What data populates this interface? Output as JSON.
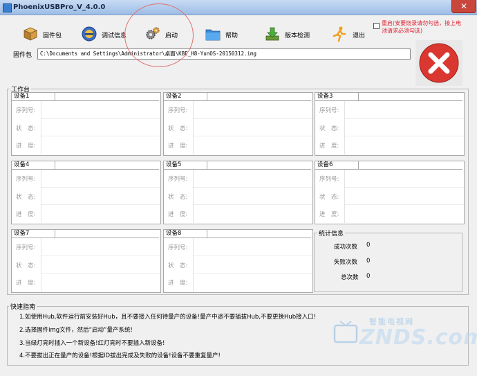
{
  "window": {
    "title": "PhoenixUSBPro_V_4.0.0",
    "close_glyph": "✕"
  },
  "toolbar": {
    "items": [
      {
        "label": "固件包",
        "icon": "package-icon"
      },
      {
        "label": "调试信息",
        "icon": "debug-icon"
      },
      {
        "label": "启动",
        "icon": "gear-icon"
      },
      {
        "label": "帮助",
        "icon": "folder-help-icon"
      },
      {
        "label": "版本检测",
        "icon": "download-icon"
      },
      {
        "label": "退出",
        "icon": "running-man-icon"
      }
    ],
    "restart_text": "重启(安要烧录请勿勾选，接上电池请求必须勾选)"
  },
  "firmware": {
    "label": "固件包",
    "path": "C:\\Documents and Settings\\Administrator\\桌面\\KBE_H8-YunOS-20150312.img"
  },
  "workbench": {
    "label": "工作台",
    "devices": [
      {
        "name": "设备1"
      },
      {
        "name": "设备2"
      },
      {
        "name": "设备3"
      },
      {
        "name": "设备4"
      },
      {
        "name": "设备5"
      },
      {
        "name": "设备6"
      },
      {
        "name": "设备7"
      },
      {
        "name": "设备8"
      }
    ],
    "row_labels": {
      "serial": "序列号:",
      "status": "状　态:",
      "progress": "进　度:"
    }
  },
  "stats": {
    "label": "统计信息",
    "success_label": "成功次数",
    "success_value": "0",
    "fail_label": "失败次数",
    "fail_value": "0",
    "total_label": "总次数",
    "total_value": "0"
  },
  "guide": {
    "label": "快速指南",
    "lines": [
      "1.如使用Hub,软件运行前安装好Hub，且不要接入任何待量产的设备!量产中途不要插拔Hub,不要更换Hub接入口!",
      "2.选择固件img文件，然后“启动”量产系统!",
      "3.当绿灯亮时插入一个新设备!红灯亮时不要插入新设备!",
      "4.不要拔出正在量产的设备!根据ID拔出完成及失败的设备!设备不要重复量产!"
    ]
  },
  "watermark": {
    "top": "智能电视网",
    "main": "ZNDS.com"
  },
  "colors": {
    "accent_red": "#d9372f",
    "title_bg": "#b4cdee",
    "annotation": "#e07070"
  }
}
